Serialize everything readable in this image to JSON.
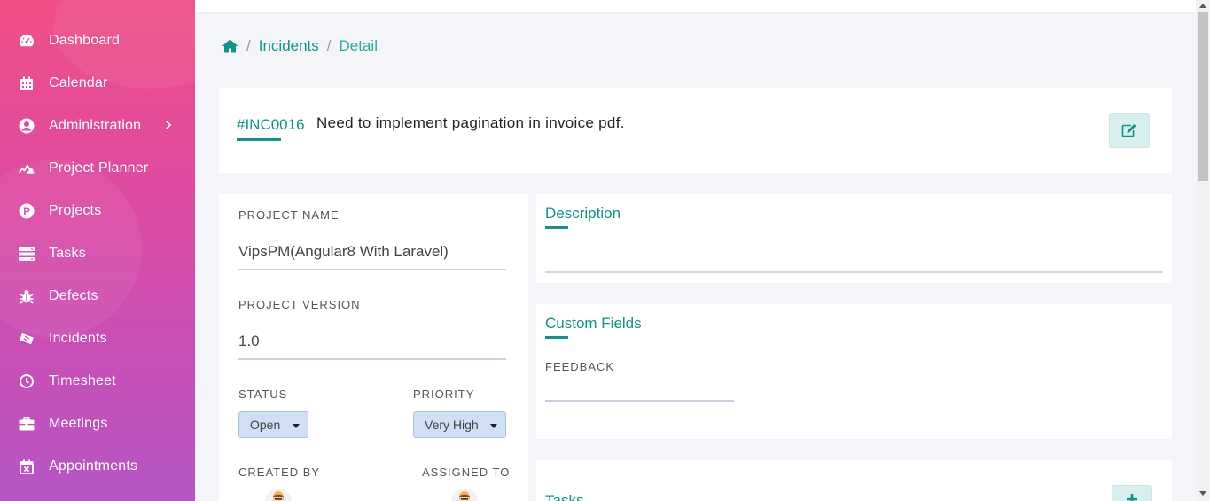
{
  "sidebar": {
    "items": [
      {
        "label": "Dashboard",
        "icon": "dashboard-icon"
      },
      {
        "label": "Calendar",
        "icon": "calendar-icon"
      },
      {
        "label": "Administration",
        "icon": "user-circle-icon",
        "has_submenu": true
      },
      {
        "label": "Project Planner",
        "icon": "project-planner-icon"
      },
      {
        "label": "Projects",
        "icon": "projects-p-icon"
      },
      {
        "label": "Tasks",
        "icon": "tasks-icon"
      },
      {
        "label": "Defects",
        "icon": "bug-icon"
      },
      {
        "label": "Incidents",
        "icon": "ticket-icon"
      },
      {
        "label": "Timesheet",
        "icon": "clock-icon"
      },
      {
        "label": "Meetings",
        "icon": "briefcase-icon"
      },
      {
        "label": "Appointments",
        "icon": "calendar-x-icon"
      }
    ]
  },
  "breadcrumb": {
    "home_icon": "home-icon",
    "incidents": "Incidents",
    "detail": "Detail"
  },
  "incident": {
    "code": "#INC0016",
    "title": "Need to implement pagination in invoice pdf."
  },
  "details": {
    "project_name_label": "PROJECT NAME",
    "project_name": "VipsPM(Angular8 With Laravel)",
    "project_version_label": "PROJECT VERSION",
    "project_version": "1.0",
    "status_label": "STATUS",
    "status": "Open",
    "priority_label": "PRIORITY",
    "priority": "Very High",
    "created_by_label": "CREATED BY",
    "assigned_to_label": "ASSIGNED TO"
  },
  "description": {
    "title": "Description"
  },
  "custom_fields": {
    "title": "Custom Fields",
    "feedback_label": "FEEDBACK",
    "feedback_value": ""
  },
  "tasks": {
    "title": "Tasks"
  },
  "colors": {
    "accent": "#0f9488",
    "sidebar_top": "#f14f86",
    "sidebar_bottom": "#b456c4"
  }
}
